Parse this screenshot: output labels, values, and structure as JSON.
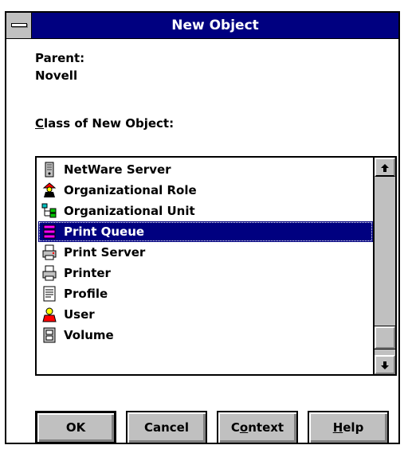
{
  "window": {
    "title": "New Object"
  },
  "parent": {
    "label": "Parent:",
    "value": "Novell"
  },
  "class_label": {
    "mnemonic": "C",
    "rest": "lass of New Object:"
  },
  "list": {
    "items": [
      {
        "label": "NetWare Server",
        "icon": "server-icon"
      },
      {
        "label": "Organizational Role",
        "icon": "organizational-role-icon"
      },
      {
        "label": "Organizational Unit",
        "icon": "organizational-unit-icon"
      },
      {
        "label": "Print Queue",
        "icon": "print-queue-icon",
        "selected": true
      },
      {
        "label": "Print Server",
        "icon": "print-server-icon"
      },
      {
        "label": "Printer",
        "icon": "printer-icon"
      },
      {
        "label": "Profile",
        "icon": "profile-icon"
      },
      {
        "label": "User",
        "icon": "user-icon"
      },
      {
        "label": "Volume",
        "icon": "volume-icon"
      }
    ]
  },
  "buttons": {
    "ok": "OK",
    "cancel": "Cancel",
    "context": {
      "before": "C",
      "mnemonic": "o",
      "after": "ntext"
    },
    "help": {
      "mnemonic": "H",
      "after": "elp"
    }
  },
  "colors": {
    "titlebar": "#000080",
    "selection": "#000080",
    "face": "#c0c0c0"
  }
}
